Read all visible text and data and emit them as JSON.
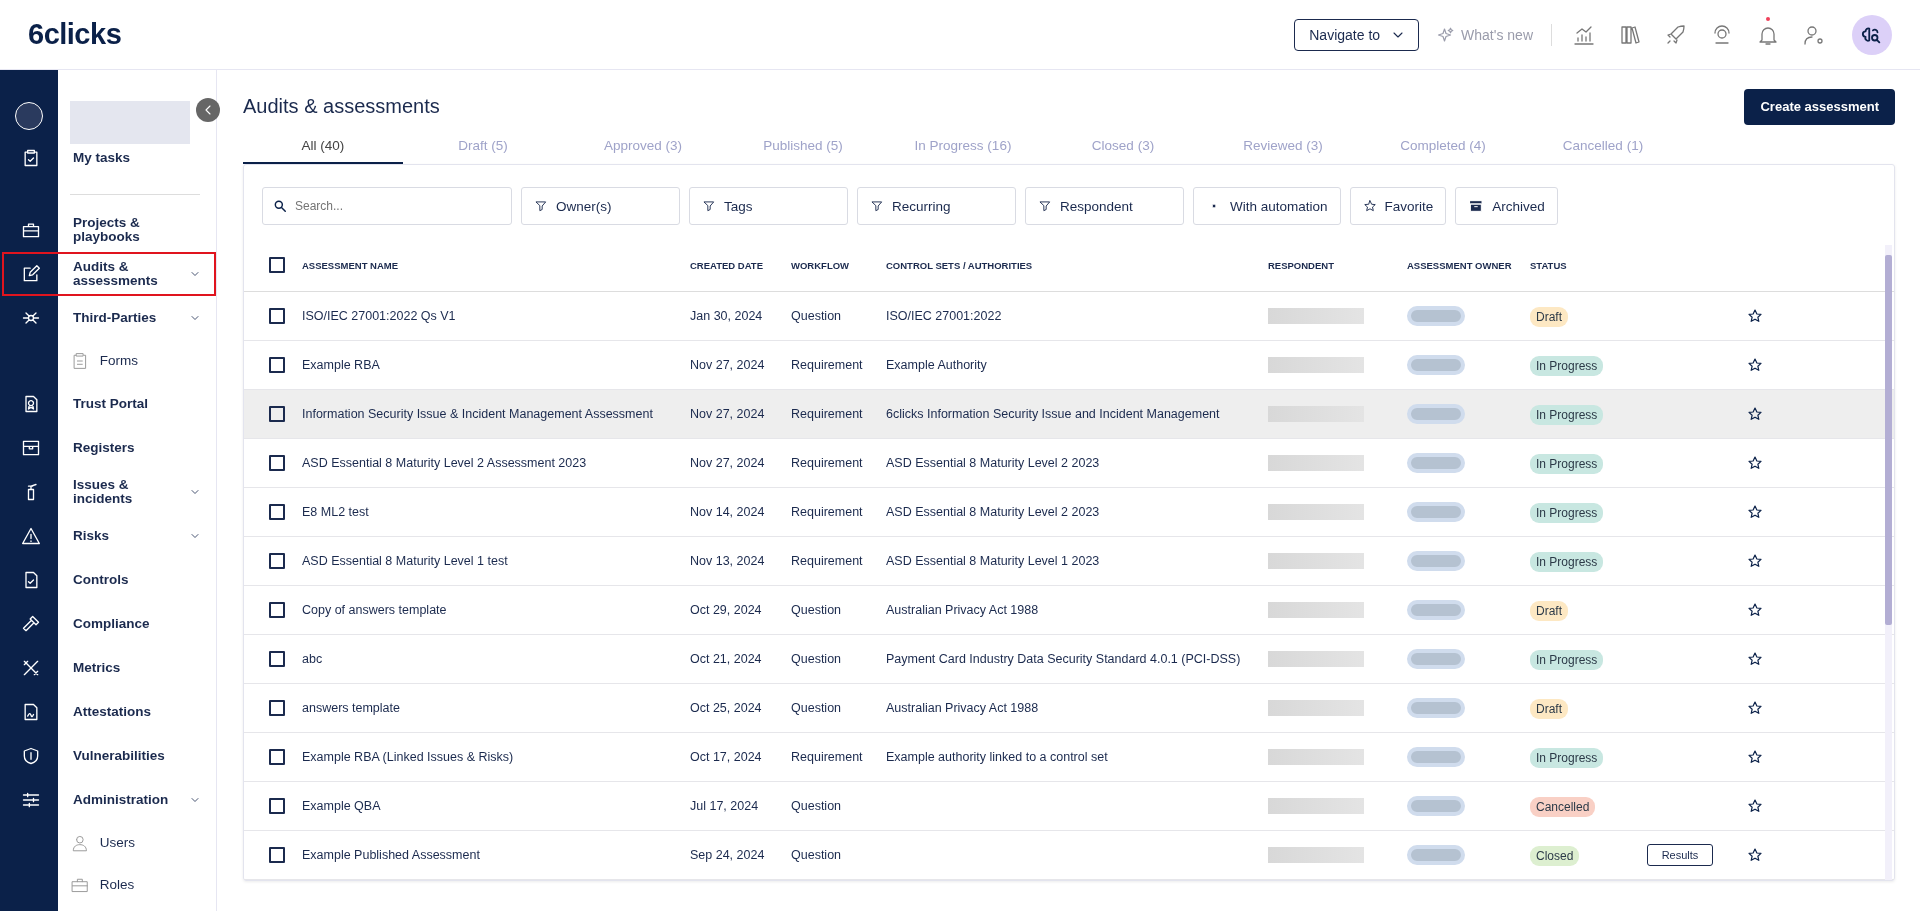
{
  "header": {
    "logo": "6clicks",
    "navigate_button": "Navigate to",
    "whats_new": "What's new",
    "notifications_unread": true
  },
  "sidebar": {
    "top_items": [
      {
        "label": "My tasks"
      }
    ],
    "items": [
      {
        "label": "Projects & playbooks",
        "kind": "link",
        "selected": false
      },
      {
        "label": "Audits & assessments",
        "kind": "group",
        "selected": true
      },
      {
        "label": "Third-Parties",
        "kind": "group",
        "selected": false,
        "children": [
          {
            "label": "Forms",
            "selected": false
          }
        ]
      },
      {
        "label": "Trust Portal",
        "kind": "link",
        "selected": false
      },
      {
        "label": "Registers",
        "kind": "link",
        "selected": false
      },
      {
        "label": "Issues & incidents",
        "kind": "group",
        "selected": false
      },
      {
        "label": "Risks",
        "kind": "group",
        "selected": false
      },
      {
        "label": "Controls",
        "kind": "link",
        "selected": false
      },
      {
        "label": "Compliance",
        "kind": "link",
        "selected": false
      },
      {
        "label": "Metrics",
        "kind": "link",
        "selected": false
      },
      {
        "label": "Attestations",
        "kind": "link",
        "selected": false
      },
      {
        "label": "Vulnerabilities",
        "kind": "link",
        "selected": false
      },
      {
        "label": "Administration",
        "kind": "group",
        "selected": false,
        "children": [
          {
            "label": "Users",
            "selected": false
          },
          {
            "label": "Roles",
            "selected": false
          }
        ]
      }
    ]
  },
  "page": {
    "title": "Audits & assessments",
    "create_button": "Create assessment",
    "tabs": [
      {
        "label": "All (40)",
        "selected": true
      },
      {
        "label": "Draft (5)",
        "selected": false
      },
      {
        "label": "Approved (3)",
        "selected": false
      },
      {
        "label": "Published (5)",
        "selected": false
      },
      {
        "label": "In Progress (16)",
        "selected": false
      },
      {
        "label": "Closed (3)",
        "selected": false
      },
      {
        "label": "Reviewed (3)",
        "selected": false
      },
      {
        "label": "Completed (4)",
        "selected": false
      },
      {
        "label": "Cancelled (1)",
        "selected": false
      }
    ],
    "search": {
      "placeholder": "Search..."
    },
    "filters": [
      {
        "label": "Owner(s)",
        "kind": "filter"
      },
      {
        "label": "Tags",
        "kind": "filter"
      },
      {
        "label": "Recurring",
        "kind": "filter"
      },
      {
        "label": "Respondent",
        "kind": "filter"
      },
      {
        "label": "With automation",
        "kind": "automation"
      },
      {
        "label": "Favorite",
        "kind": "favorite"
      },
      {
        "label": "Archived",
        "kind": "archive"
      }
    ]
  },
  "table": {
    "all_checked": false,
    "columns": [
      "ASSESSMENT NAME",
      "CREATED DATE",
      "WORKFLOW",
      "CONTROL SETS / AUTHORITIES",
      "RESPONDENT",
      "ASSESSMENT OWNER",
      "STATUS"
    ],
    "rows": [
      {
        "checked": false,
        "hovered": false,
        "name": "ISO/IEC 27001:2022 Qs V1",
        "created": "Jan 30, 2024",
        "workflow": "Question",
        "control_set": "ISO/IEC 27001:2022",
        "status": {
          "label": "Draft",
          "color": "#fde8c3"
        },
        "favorite": false
      },
      {
        "checked": false,
        "hovered": false,
        "name": "Example RBA",
        "created": "Nov 27, 2024",
        "workflow": "Requirement",
        "control_set": "Example Authority",
        "status": {
          "label": "In Progress",
          "color": "#c8e7e1"
        },
        "favorite": false
      },
      {
        "checked": false,
        "hovered": true,
        "name": "Information Security Issue & Incident Management Assessment",
        "created": "Nov 27, 2024",
        "workflow": "Requirement",
        "control_set": "6clicks Information Security Issue and Incident Management",
        "status": {
          "label": "In Progress",
          "color": "#c8e7e1"
        },
        "favorite": false
      },
      {
        "checked": false,
        "hovered": false,
        "name": "ASD Essential 8 Maturity Level 2 Assessment 2023",
        "created": "Nov 27, 2024",
        "workflow": "Requirement",
        "control_set": "ASD Essential 8 Maturity Level 2 2023",
        "status": {
          "label": "In Progress",
          "color": "#c8e7e1"
        },
        "favorite": false
      },
      {
        "checked": false,
        "hovered": false,
        "name": "E8 ML2 test",
        "created": "Nov 14, 2024",
        "workflow": "Requirement",
        "control_set": "ASD Essential 8 Maturity Level 2 2023",
        "status": {
          "label": "In Progress",
          "color": "#c8e7e1"
        },
        "favorite": false
      },
      {
        "checked": false,
        "hovered": false,
        "name": "ASD Essential 8 Maturity Level 1 test",
        "created": "Nov 13, 2024",
        "workflow": "Requirement",
        "control_set": "ASD Essential 8 Maturity Level 1 2023",
        "status": {
          "label": "In Progress",
          "color": "#c8e7e1"
        },
        "favorite": false
      },
      {
        "checked": false,
        "hovered": false,
        "name": "Copy of answers template",
        "created": "Oct 29, 2024",
        "workflow": "Question",
        "control_set": "Australian Privacy Act 1988",
        "status": {
          "label": "Draft",
          "color": "#fde8c3"
        },
        "favorite": false
      },
      {
        "checked": false,
        "hovered": false,
        "name": "abc",
        "created": "Oct 21, 2024",
        "workflow": "Question",
        "control_set": "Payment Card Industry Data Security Standard 4.0.1 (PCI-DSS)",
        "status": {
          "label": "In Progress",
          "color": "#c8e7e1"
        },
        "favorite": false
      },
      {
        "checked": false,
        "hovered": false,
        "name": "answers template",
        "created": "Oct 25, 2024",
        "workflow": "Question",
        "control_set": "Australian Privacy Act 1988",
        "status": {
          "label": "Draft",
          "color": "#fde8c3"
        },
        "favorite": false
      },
      {
        "checked": false,
        "hovered": false,
        "name": "Example RBA (Linked Issues & Risks)",
        "created": "Oct 17, 2024",
        "workflow": "Requirement",
        "control_set": "Example authority linked to a control set",
        "status": {
          "label": "In Progress",
          "color": "#c8e7e1"
        },
        "favorite": false
      },
      {
        "checked": false,
        "hovered": false,
        "name": "Example QBA",
        "created": "Jul 17, 2024",
        "workflow": "Question",
        "status": {
          "label": "Cancelled",
          "color": "#f9d0c5"
        },
        "favorite": false
      },
      {
        "checked": false,
        "hovered": false,
        "name": "Example Published Assessment",
        "created": "Sep 24, 2024",
        "workflow": "Question",
        "status": {
          "label": "Closed",
          "color": "#ddefd0"
        },
        "action": "Results",
        "favorite": false
      }
    ]
  }
}
